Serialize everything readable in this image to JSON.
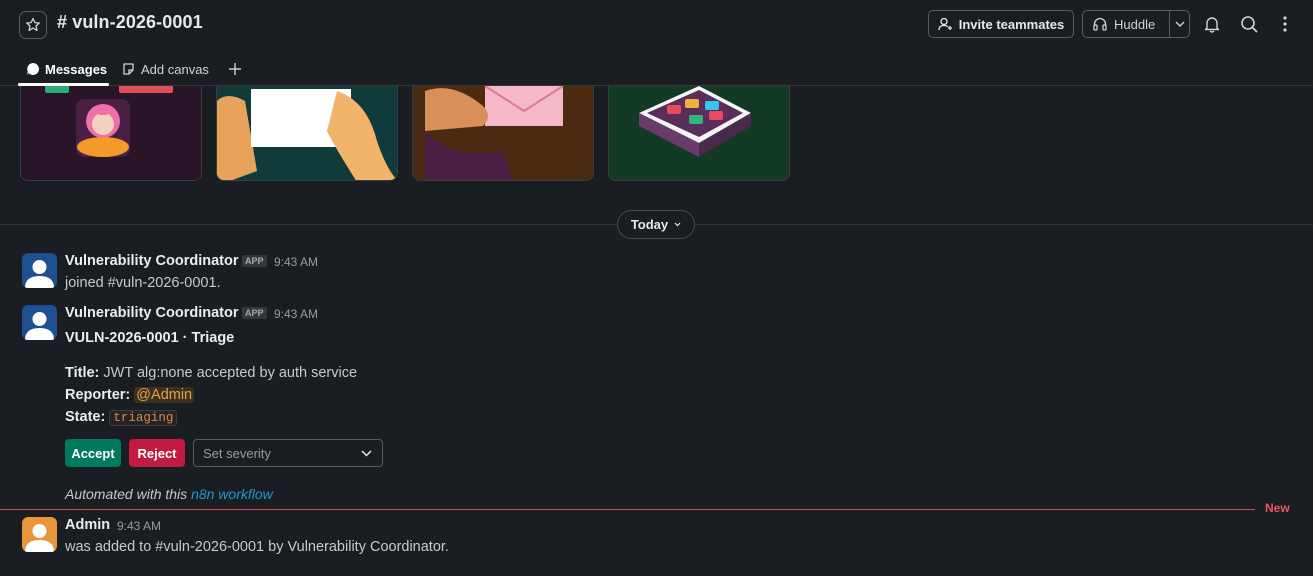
{
  "header": {
    "channel_title": "# vuln-2026-0001",
    "invite_label": "Invite teammates",
    "huddle_label": "Huddle"
  },
  "tabs": [
    {
      "label": "Messages",
      "active": true
    },
    {
      "label": "Add canvas",
      "active": false
    }
  ],
  "divider": {
    "label": "Today"
  },
  "messages": [
    {
      "author": "Vulnerability Coordinator",
      "badge": "APP",
      "time": "9:43 AM",
      "text": "joined #vuln-2026-0001."
    },
    {
      "author": "Vulnerability Coordinator",
      "badge": "APP",
      "time": "9:43 AM",
      "heading": "VULN-2026-0001 · Triage",
      "fields": {
        "title_label": "Title:",
        "title_value": "JWT alg:none accepted by auth service",
        "reporter_label": "Reporter:",
        "reporter_value": "@Admin",
        "state_label": "State:",
        "state_value": "triaging"
      },
      "actions": {
        "accept": "Accept",
        "reject": "Reject",
        "severity_placeholder": "Set severity"
      },
      "footer_prefix": "Automated with this",
      "footer_link": "n8n workflow"
    },
    {
      "author": "Admin",
      "time": "9:43 AM",
      "text": "was added to #vuln-2026-0001 by Vulnerability Coordinator."
    }
  ],
  "new_marker": "New",
  "colors": {
    "accept": "#007a5a",
    "reject": "#c11c3f",
    "link": "#1d9bd1",
    "mention": "#e8a33d",
    "new": "#e55b5b"
  }
}
